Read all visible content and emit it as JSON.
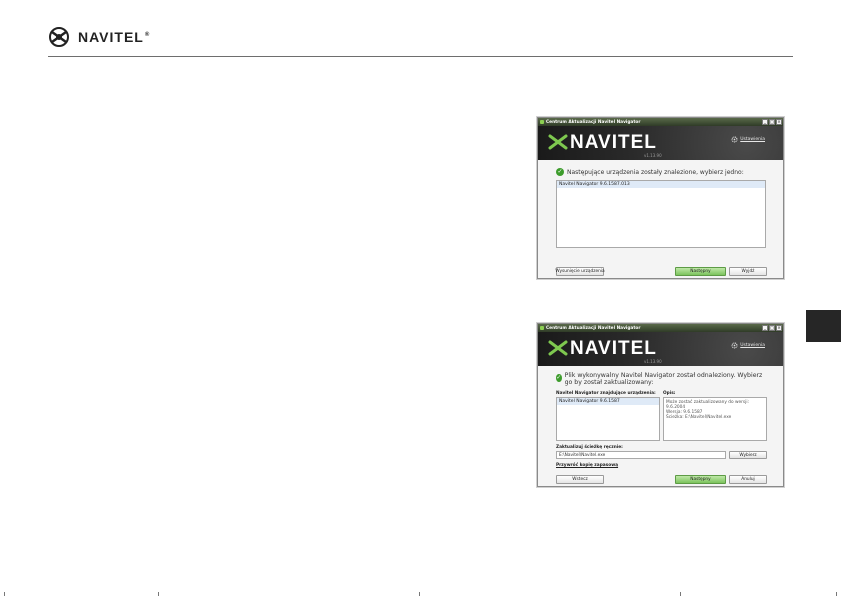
{
  "header": {
    "logo_text": "NAVITEL",
    "logo_reg": "®"
  },
  "window1": {
    "title": "Centrum Aktualizacji Navitel Navigator",
    "brand": "NAVITEL",
    "version": "v1.13.90",
    "settings_label": "Ustawienia",
    "message": "Następujące urządzenia zostały znalezione, wybierz jedno:",
    "devices": [
      "Navitel Navigator 9.6.1587.013"
    ],
    "buttons": {
      "eject": "Wysunięcie urządzenia",
      "next": "Następny",
      "exit": "Wyjdź"
    }
  },
  "window2": {
    "title": "Centrum Aktualizacji Navitel Navigator",
    "brand": "NAVITEL",
    "version": "v1.13.90",
    "settings_label": "Ustawienia",
    "message": "Plik wykonywalny Navitel Navigator został odnaleziony. Wybierz go by został zaktualizowany:",
    "list_label": "Navitel Navigator znajdujące urządzenia:",
    "devices": [
      "Navitel Navigator 9.6.1587"
    ],
    "desc_label": "Opis:",
    "desc_lines": [
      "Może zostać zaktualizowany do wersji:",
      "9.6.2004",
      "Wersja: 9.6.1587",
      "Ścieżka: E:\\Navitel\\Navitel.exe"
    ],
    "path_label": "Zaktualizuj ścieżkę ręcznie:",
    "path_value": "E:\\Navitel\\Navitel.exe",
    "browse_label": "Wybierz",
    "restore_link": "Przywróć kopię zapasową",
    "buttons": {
      "back": "Wstecz",
      "next": "Następny",
      "cancel": "Anuluj"
    }
  }
}
